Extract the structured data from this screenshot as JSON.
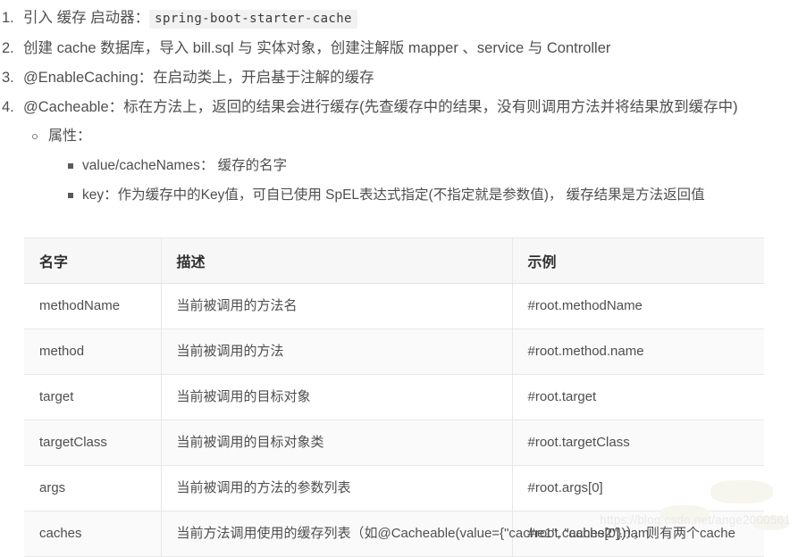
{
  "document": {
    "list": [
      {
        "marker": "1.",
        "text_before": "引入 缓存 启动器：",
        "code": "spring-boot-starter-cache",
        "text_after": ""
      },
      {
        "marker": "2.",
        "text_before": "创建 cache 数据库，导入 bill.sql 与 实体对象，创建注解版 mapper 、service 与 Controller",
        "code": "",
        "text_after": ""
      },
      {
        "marker": "3.",
        "text_before": "@EnableCaching：在启动类上，开启基于注解的缓存",
        "code": "",
        "text_after": ""
      },
      {
        "marker": "4.",
        "text_before": "@Cacheable：标在方法上，返回的结果会进行缓存(先查缓存中的结果，没有则调用方法并将结果放到缓存中)",
        "code": "",
        "text_after": ""
      }
    ],
    "sublist_level2": [
      {
        "label": "属性："
      }
    ],
    "sublist_level3": [
      {
        "label": "value/cacheNames： 缓存的名字"
      },
      {
        "label": "key：作为缓存中的Key值，可自已使用 SpEL表达式指定(不指定就是参数值)， 缓存结果是方法返回值"
      }
    ]
  },
  "table": {
    "headers": [
      "名字",
      "描述",
      "示例"
    ],
    "rows": [
      {
        "name": "methodName",
        "desc": "当前被调用的方法名",
        "example": "#root.methodName"
      },
      {
        "name": "method",
        "desc": "当前被调用的方法",
        "example": "#root.method.name"
      },
      {
        "name": "target",
        "desc": "当前被调用的目标对象",
        "example": "#root.target"
      },
      {
        "name": "targetClass",
        "desc": "当前被调用的目标对象类",
        "example": "#root.targetClass"
      },
      {
        "name": "args",
        "desc": "当前被调用的方法的参数列表",
        "example": "#root.args[0]"
      },
      {
        "name": "caches",
        "desc": "当前方法调用使用的缓存列表（如@Cacheable(value={\"cache1\", \"cache2\"})），则有两个cache",
        "example": "#root.caches[0].nam"
      }
    ]
  },
  "watermark": {
    "text": "https://blog.csdn.net/ange2000561"
  },
  "colors": {
    "text": "#4f4f4f",
    "heading": "#2f2f2f",
    "code_background": "#f2f2f2",
    "table_header_background": "#f7f7f7",
    "table_border": "#e8e8e8",
    "row_alt_background": "#fafafa",
    "watermark": "#e9e9e9"
  }
}
